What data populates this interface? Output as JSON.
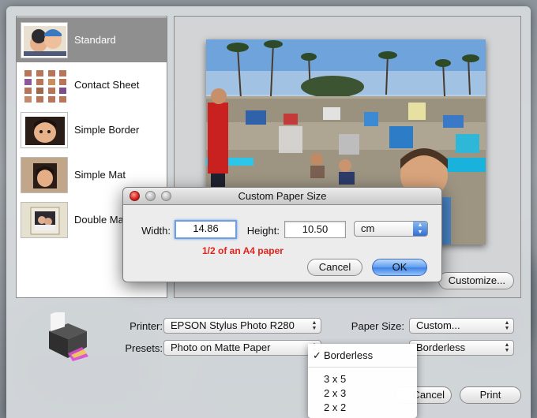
{
  "styles": [
    {
      "label": "Standard",
      "selected": true
    },
    {
      "label": "Contact Sheet",
      "selected": false
    },
    {
      "label": "Simple Border",
      "selected": false
    },
    {
      "label": "Simple Mat",
      "selected": false
    },
    {
      "label": "Double Mat",
      "selected": false
    }
  ],
  "preview": {
    "customize_label": "Customize..."
  },
  "settings": {
    "printer_label": "Printer:",
    "printer_value": "EPSON Stylus Photo R280",
    "presets_label": "Presets:",
    "presets_value": "Photo on Matte Paper",
    "paper_size_label": "Paper Size:",
    "paper_size_value": "Custom...",
    "print_size_value": "Borderless"
  },
  "print_size_menu": {
    "items": [
      {
        "label": "Borderless",
        "checked": true
      },
      {
        "label": "3 x 5",
        "checked": false
      },
      {
        "label": "2 x 3",
        "checked": false
      },
      {
        "label": "2 x 2",
        "checked": false
      }
    ]
  },
  "buttons": {
    "cancel_label": "Cancel",
    "print_label": "Print"
  },
  "dialog": {
    "title": "Custom Paper Size",
    "width_label": "Width:",
    "width_value": "14.86",
    "height_label": "Height:",
    "height_value": "10.50",
    "unit_value": "cm",
    "hint": "1/2 of an A4 paper",
    "cancel_label": "Cancel",
    "ok_label": "OK"
  },
  "colors": {
    "accent": "#3b81e8",
    "hint": "#e3231b",
    "selection": "#8f8f8f"
  }
}
